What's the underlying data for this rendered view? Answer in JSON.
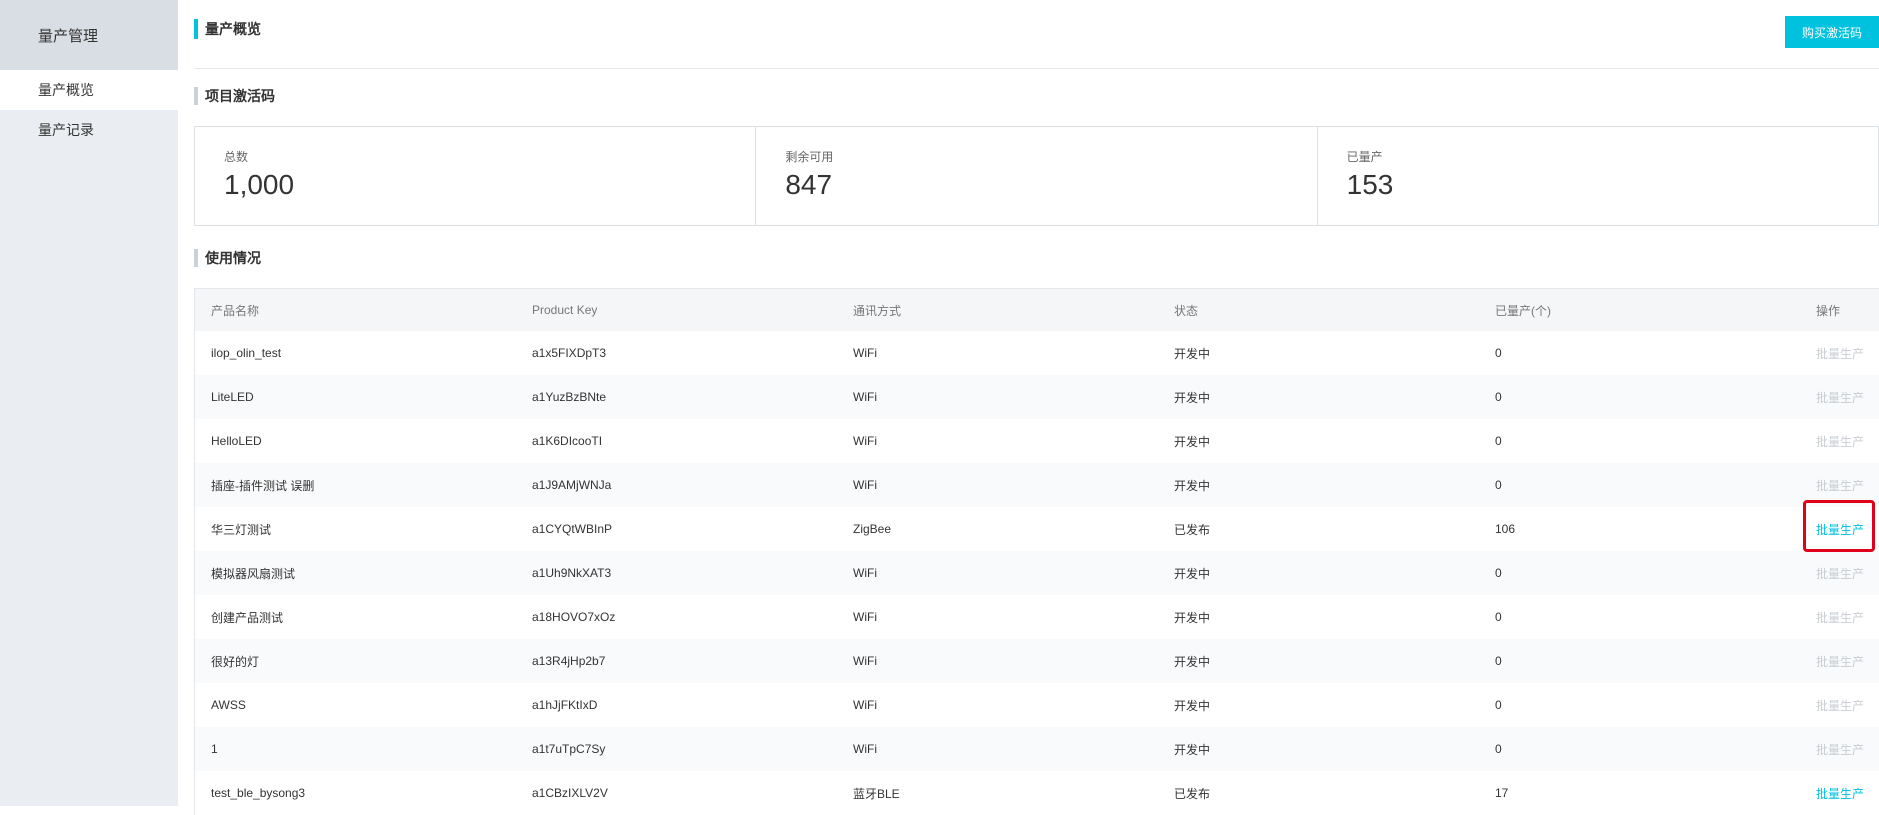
{
  "sidebar": {
    "title": "量产管理",
    "items": [
      {
        "label": "量产概览",
        "active": true
      },
      {
        "label": "量产记录",
        "active": false
      }
    ]
  },
  "header": {
    "title": "量产概览",
    "buy_button": "购买激活码"
  },
  "activation": {
    "section_title": "项目激活码",
    "stats": [
      {
        "label": "总数",
        "value": "1,000"
      },
      {
        "label": "剩余可用",
        "value": "847"
      },
      {
        "label": "已量产",
        "value": "153"
      }
    ]
  },
  "usage": {
    "section_title": "使用情况",
    "columns": [
      "产品名称",
      "Product Key",
      "通讯方式",
      "状态",
      "已量产(个)",
      "操作"
    ],
    "rows": [
      {
        "name": "ilop_olin_test",
        "key": "a1x5FIXDpT3",
        "comm": "WiFi",
        "status": "开发中",
        "count": "0",
        "action": "批量生产",
        "enabled": false
      },
      {
        "name": "LiteLED",
        "key": "a1YuzBzBNte",
        "comm": "WiFi",
        "status": "开发中",
        "count": "0",
        "action": "批量生产",
        "enabled": false
      },
      {
        "name": "HelloLED",
        "key": "a1K6DIcooTI",
        "comm": "WiFi",
        "status": "开发中",
        "count": "0",
        "action": "批量生产",
        "enabled": false
      },
      {
        "name": "插座-插件测试 误删",
        "key": "a1J9AMjWNJa",
        "comm": "WiFi",
        "status": "开发中",
        "count": "0",
        "action": "批量生产",
        "enabled": false
      },
      {
        "name": "华三灯测试",
        "key": "a1CYQtWBInP",
        "comm": "ZigBee",
        "status": "已发布",
        "count": "106",
        "action": "批量生产",
        "enabled": true
      },
      {
        "name": "模拟器风扇测试",
        "key": "a1Uh9NkXAT3",
        "comm": "WiFi",
        "status": "开发中",
        "count": "0",
        "action": "批量生产",
        "enabled": false
      },
      {
        "name": "创建产品测试",
        "key": "a18HOVO7xOz",
        "comm": "WiFi",
        "status": "开发中",
        "count": "0",
        "action": "批量生产",
        "enabled": false
      },
      {
        "name": "很好的灯",
        "key": "a13R4jHp2b7",
        "comm": "WiFi",
        "status": "开发中",
        "count": "0",
        "action": "批量生产",
        "enabled": false
      },
      {
        "name": "AWSS",
        "key": "a1hJjFKtIxD",
        "comm": "WiFi",
        "status": "开发中",
        "count": "0",
        "action": "批量生产",
        "enabled": false
      },
      {
        "name": "1",
        "key": "a1t7uTpC7Sy",
        "comm": "WiFi",
        "status": "开发中",
        "count": "0",
        "action": "批量生产",
        "enabled": false
      },
      {
        "name": "test_ble_bysong3",
        "key": "a1CBzIXLV2V",
        "comm": "蓝牙BLE",
        "status": "已发布",
        "count": "17",
        "action": "批量生产",
        "enabled": true
      }
    ]
  },
  "colors": {
    "accent": "#00c1de",
    "highlight": "#e0001b",
    "sidebar_bg": "#eaedf1"
  }
}
